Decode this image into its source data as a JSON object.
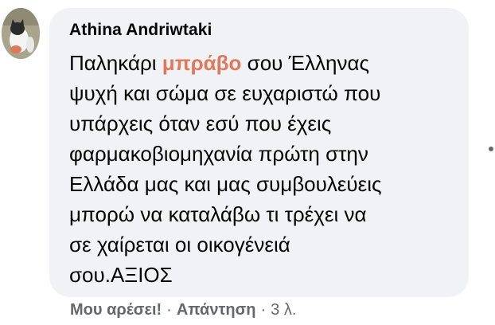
{
  "comment": {
    "author": "Athina Andriwtaki",
    "text_lines": [
      {
        "before": "Παληκάρι ",
        "highlight": "μπράβο",
        "after": " σου Έλληνας"
      },
      {
        "before": "ψυχή και σώμα σε ευχαριστώ που",
        "highlight": "",
        "after": ""
      },
      {
        "before": "υπάρχεις όταν εσύ που έχεις",
        "highlight": "",
        "after": ""
      },
      {
        "before": "φαρμακοβιομηχανία πρώτη στην",
        "highlight": "",
        "after": ""
      },
      {
        "before": "Ελλάδα μας και μας συμβουλεύεις",
        "highlight": "",
        "after": ""
      },
      {
        "before": "μπορώ να καταλάβω τι τρέχει να",
        "highlight": "",
        "after": ""
      },
      {
        "before": "σε χαίρεται οι οικογένειά",
        "highlight": "",
        "after": ""
      },
      {
        "before": "σου.ΑΞΙΟΣ",
        "highlight": "",
        "after": ""
      }
    ],
    "highlight_color": "#e0785a"
  },
  "actions": {
    "like_label": "Μου αρέσει!",
    "separator": "·",
    "reply_label": "Απάντηση",
    "time_label": "3 λ."
  },
  "icons": {
    "avatar": "profile-photo-cat",
    "menu": "more-options-dot"
  }
}
